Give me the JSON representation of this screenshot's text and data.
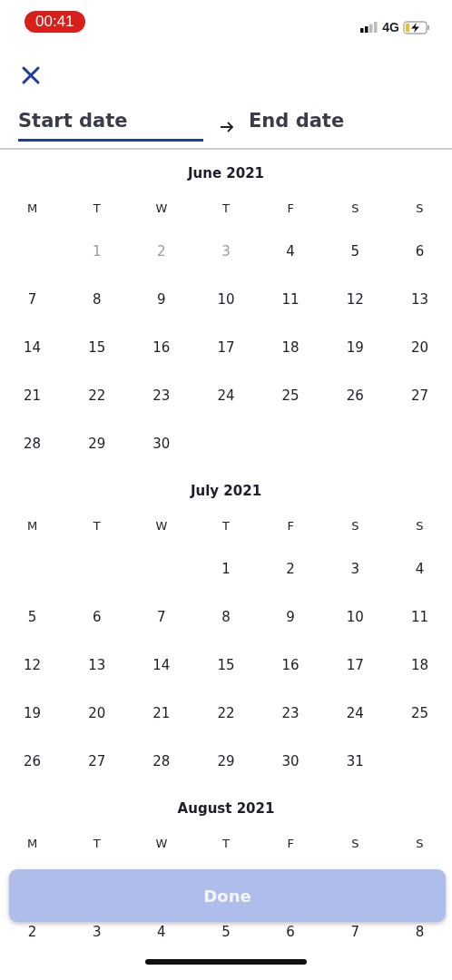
{
  "status_bar": {
    "time": "00:41",
    "network": "4G"
  },
  "tabs": [
    {
      "label": "Start date",
      "selected": true
    },
    {
      "label": "End date",
      "selected": false
    }
  ],
  "months": [
    {
      "title": "June 2021",
      "weekdays": [
        "M",
        "T",
        "W",
        "T",
        "F",
        "S",
        "S"
      ],
      "weeks": [
        {
          "kind": "first",
          "days": [
            {
              "day": "1",
              "disabled": true
            },
            {
              "day": "2",
              "disabled": true
            },
            {
              "day": "3",
              "disabled": true
            },
            {
              "day": "4",
              "disabled": false
            },
            {
              "day": "5",
              "disabled": false
            },
            {
              "day": "6",
              "disabled": false
            }
          ]
        },
        {
          "kind": "full",
          "days": [
            {
              "day": "7",
              "disabled": false
            },
            {
              "day": "8",
              "disabled": false
            },
            {
              "day": "9",
              "disabled": false
            },
            {
              "day": "10",
              "disabled": false
            },
            {
              "day": "11",
              "disabled": false
            },
            {
              "day": "12",
              "disabled": false
            },
            {
              "day": "13",
              "disabled": false
            }
          ]
        },
        {
          "kind": "full",
          "days": [
            {
              "day": "14",
              "disabled": false
            },
            {
              "day": "15",
              "disabled": false
            },
            {
              "day": "16",
              "disabled": false
            },
            {
              "day": "17",
              "disabled": false
            },
            {
              "day": "18",
              "disabled": false
            },
            {
              "day": "19",
              "disabled": false
            },
            {
              "day": "20",
              "disabled": false
            }
          ]
        },
        {
          "kind": "full",
          "days": [
            {
              "day": "21",
              "disabled": false
            },
            {
              "day": "22",
              "disabled": false
            },
            {
              "day": "23",
              "disabled": false
            },
            {
              "day": "24",
              "disabled": false
            },
            {
              "day": "25",
              "disabled": false
            },
            {
              "day": "26",
              "disabled": false
            },
            {
              "day": "27",
              "disabled": false
            }
          ]
        },
        {
          "kind": "last",
          "days": [
            {
              "day": "28",
              "disabled": false
            },
            {
              "day": "29",
              "disabled": false
            },
            {
              "day": "30",
              "disabled": false
            }
          ]
        }
      ]
    },
    {
      "title": "July 2021",
      "weekdays": [
        "M",
        "T",
        "W",
        "T",
        "F",
        "S",
        "S"
      ],
      "weeks": [
        {
          "kind": "first",
          "days": [
            {
              "day": "1",
              "disabled": false
            },
            {
              "day": "2",
              "disabled": false
            },
            {
              "day": "3",
              "disabled": false
            },
            {
              "day": "4",
              "disabled": false
            }
          ]
        },
        {
          "kind": "full",
          "days": [
            {
              "day": "5",
              "disabled": false
            },
            {
              "day": "6",
              "disabled": false
            },
            {
              "day": "7",
              "disabled": false
            },
            {
              "day": "8",
              "disabled": false
            },
            {
              "day": "9",
              "disabled": false
            },
            {
              "day": "10",
              "disabled": false
            },
            {
              "day": "11",
              "disabled": false
            }
          ]
        },
        {
          "kind": "full",
          "days": [
            {
              "day": "12",
              "disabled": false
            },
            {
              "day": "13",
              "disabled": false
            },
            {
              "day": "14",
              "disabled": false
            },
            {
              "day": "15",
              "disabled": false
            },
            {
              "day": "16",
              "disabled": false
            },
            {
              "day": "17",
              "disabled": false
            },
            {
              "day": "18",
              "disabled": false
            }
          ]
        },
        {
          "kind": "full",
          "days": [
            {
              "day": "19",
              "disabled": false
            },
            {
              "day": "20",
              "disabled": false
            },
            {
              "day": "21",
              "disabled": false
            },
            {
              "day": "22",
              "disabled": false
            },
            {
              "day": "23",
              "disabled": false
            },
            {
              "day": "24",
              "disabled": false
            },
            {
              "day": "25",
              "disabled": false
            }
          ]
        },
        {
          "kind": "last",
          "days": [
            {
              "day": "26",
              "disabled": false
            },
            {
              "day": "27",
              "disabled": false
            },
            {
              "day": "28",
              "disabled": false
            },
            {
              "day": "29",
              "disabled": false
            },
            {
              "day": "30",
              "disabled": false
            },
            {
              "day": "31",
              "disabled": false
            }
          ]
        }
      ]
    },
    {
      "title": "August 2021",
      "weekdays": [
        "M",
        "T",
        "W",
        "T",
        "F",
        "S",
        "S"
      ],
      "weeks": [
        {
          "kind": "full",
          "days": [
            {
              "day": "2",
              "disabled": false
            },
            {
              "day": "3",
              "disabled": false
            },
            {
              "day": "4",
              "disabled": false
            },
            {
              "day": "5",
              "disabled": false
            },
            {
              "day": "6",
              "disabled": false
            },
            {
              "day": "7",
              "disabled": false
            },
            {
              "day": "8",
              "disabled": false
            }
          ]
        }
      ]
    }
  ],
  "done_button": {
    "label": "Done",
    "disabled": true
  }
}
